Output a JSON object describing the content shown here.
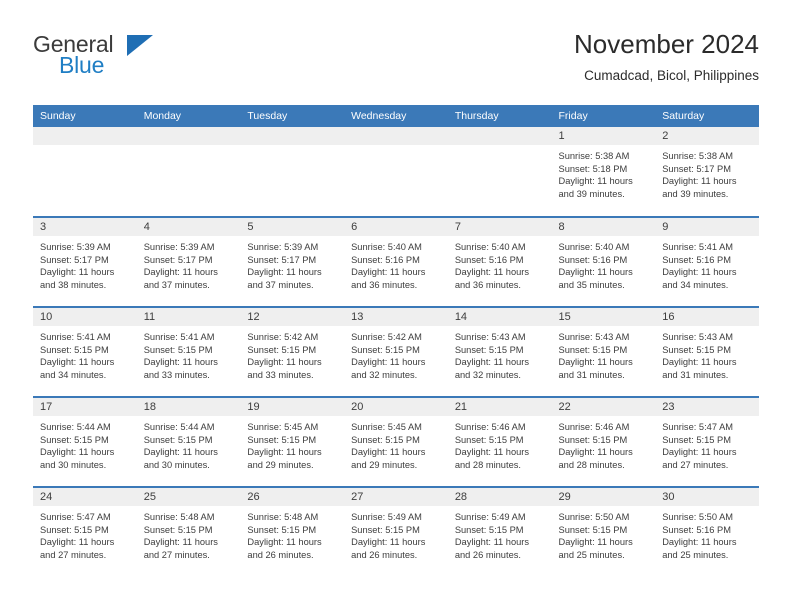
{
  "brand": {
    "line1": "General",
    "line2": "Blue",
    "triangle_icon": "triangle-icon",
    "accent_color": "#1f6eb4"
  },
  "header": {
    "title": "November 2024",
    "location": "Cumadcad, Bicol, Philippines"
  },
  "theme": {
    "header_blue": "#3b79b8",
    "daynum_band": "#efefef",
    "text": "#3d3d3d"
  },
  "weekday_headers": [
    "Sunday",
    "Monday",
    "Tuesday",
    "Wednesday",
    "Thursday",
    "Friday",
    "Saturday"
  ],
  "weeks": [
    [
      {
        "day": "",
        "sunrise": "",
        "sunset": "",
        "daylight1": "",
        "daylight2": "",
        "empty": true
      },
      {
        "day": "",
        "sunrise": "",
        "sunset": "",
        "daylight1": "",
        "daylight2": "",
        "empty": true
      },
      {
        "day": "",
        "sunrise": "",
        "sunset": "",
        "daylight1": "",
        "daylight2": "",
        "empty": true
      },
      {
        "day": "",
        "sunrise": "",
        "sunset": "",
        "daylight1": "",
        "daylight2": "",
        "empty": true
      },
      {
        "day": "",
        "sunrise": "",
        "sunset": "",
        "daylight1": "",
        "daylight2": "",
        "empty": true
      },
      {
        "day": "1",
        "sunrise": "Sunrise: 5:38 AM",
        "sunset": "Sunset: 5:18 PM",
        "daylight1": "Daylight: 11 hours",
        "daylight2": "and 39 minutes."
      },
      {
        "day": "2",
        "sunrise": "Sunrise: 5:38 AM",
        "sunset": "Sunset: 5:17 PM",
        "daylight1": "Daylight: 11 hours",
        "daylight2": "and 39 minutes."
      }
    ],
    [
      {
        "day": "3",
        "sunrise": "Sunrise: 5:39 AM",
        "sunset": "Sunset: 5:17 PM",
        "daylight1": "Daylight: 11 hours",
        "daylight2": "and 38 minutes."
      },
      {
        "day": "4",
        "sunrise": "Sunrise: 5:39 AM",
        "sunset": "Sunset: 5:17 PM",
        "daylight1": "Daylight: 11 hours",
        "daylight2": "and 37 minutes."
      },
      {
        "day": "5",
        "sunrise": "Sunrise: 5:39 AM",
        "sunset": "Sunset: 5:17 PM",
        "daylight1": "Daylight: 11 hours",
        "daylight2": "and 37 minutes."
      },
      {
        "day": "6",
        "sunrise": "Sunrise: 5:40 AM",
        "sunset": "Sunset: 5:16 PM",
        "daylight1": "Daylight: 11 hours",
        "daylight2": "and 36 minutes."
      },
      {
        "day": "7",
        "sunrise": "Sunrise: 5:40 AM",
        "sunset": "Sunset: 5:16 PM",
        "daylight1": "Daylight: 11 hours",
        "daylight2": "and 36 minutes."
      },
      {
        "day": "8",
        "sunrise": "Sunrise: 5:40 AM",
        "sunset": "Sunset: 5:16 PM",
        "daylight1": "Daylight: 11 hours",
        "daylight2": "and 35 minutes."
      },
      {
        "day": "9",
        "sunrise": "Sunrise: 5:41 AM",
        "sunset": "Sunset: 5:16 PM",
        "daylight1": "Daylight: 11 hours",
        "daylight2": "and 34 minutes."
      }
    ],
    [
      {
        "day": "10",
        "sunrise": "Sunrise: 5:41 AM",
        "sunset": "Sunset: 5:15 PM",
        "daylight1": "Daylight: 11 hours",
        "daylight2": "and 34 minutes."
      },
      {
        "day": "11",
        "sunrise": "Sunrise: 5:41 AM",
        "sunset": "Sunset: 5:15 PM",
        "daylight1": "Daylight: 11 hours",
        "daylight2": "and 33 minutes."
      },
      {
        "day": "12",
        "sunrise": "Sunrise: 5:42 AM",
        "sunset": "Sunset: 5:15 PM",
        "daylight1": "Daylight: 11 hours",
        "daylight2": "and 33 minutes."
      },
      {
        "day": "13",
        "sunrise": "Sunrise: 5:42 AM",
        "sunset": "Sunset: 5:15 PM",
        "daylight1": "Daylight: 11 hours",
        "daylight2": "and 32 minutes."
      },
      {
        "day": "14",
        "sunrise": "Sunrise: 5:43 AM",
        "sunset": "Sunset: 5:15 PM",
        "daylight1": "Daylight: 11 hours",
        "daylight2": "and 32 minutes."
      },
      {
        "day": "15",
        "sunrise": "Sunrise: 5:43 AM",
        "sunset": "Sunset: 5:15 PM",
        "daylight1": "Daylight: 11 hours",
        "daylight2": "and 31 minutes."
      },
      {
        "day": "16",
        "sunrise": "Sunrise: 5:43 AM",
        "sunset": "Sunset: 5:15 PM",
        "daylight1": "Daylight: 11 hours",
        "daylight2": "and 31 minutes."
      }
    ],
    [
      {
        "day": "17",
        "sunrise": "Sunrise: 5:44 AM",
        "sunset": "Sunset: 5:15 PM",
        "daylight1": "Daylight: 11 hours",
        "daylight2": "and 30 minutes."
      },
      {
        "day": "18",
        "sunrise": "Sunrise: 5:44 AM",
        "sunset": "Sunset: 5:15 PM",
        "daylight1": "Daylight: 11 hours",
        "daylight2": "and 30 minutes."
      },
      {
        "day": "19",
        "sunrise": "Sunrise: 5:45 AM",
        "sunset": "Sunset: 5:15 PM",
        "daylight1": "Daylight: 11 hours",
        "daylight2": "and 29 minutes."
      },
      {
        "day": "20",
        "sunrise": "Sunrise: 5:45 AM",
        "sunset": "Sunset: 5:15 PM",
        "daylight1": "Daylight: 11 hours",
        "daylight2": "and 29 minutes."
      },
      {
        "day": "21",
        "sunrise": "Sunrise: 5:46 AM",
        "sunset": "Sunset: 5:15 PM",
        "daylight1": "Daylight: 11 hours",
        "daylight2": "and 28 minutes."
      },
      {
        "day": "22",
        "sunrise": "Sunrise: 5:46 AM",
        "sunset": "Sunset: 5:15 PM",
        "daylight1": "Daylight: 11 hours",
        "daylight2": "and 28 minutes."
      },
      {
        "day": "23",
        "sunrise": "Sunrise: 5:47 AM",
        "sunset": "Sunset: 5:15 PM",
        "daylight1": "Daylight: 11 hours",
        "daylight2": "and 27 minutes."
      }
    ],
    [
      {
        "day": "24",
        "sunrise": "Sunrise: 5:47 AM",
        "sunset": "Sunset: 5:15 PM",
        "daylight1": "Daylight: 11 hours",
        "daylight2": "and 27 minutes."
      },
      {
        "day": "25",
        "sunrise": "Sunrise: 5:48 AM",
        "sunset": "Sunset: 5:15 PM",
        "daylight1": "Daylight: 11 hours",
        "daylight2": "and 27 minutes."
      },
      {
        "day": "26",
        "sunrise": "Sunrise: 5:48 AM",
        "sunset": "Sunset: 5:15 PM",
        "daylight1": "Daylight: 11 hours",
        "daylight2": "and 26 minutes."
      },
      {
        "day": "27",
        "sunrise": "Sunrise: 5:49 AM",
        "sunset": "Sunset: 5:15 PM",
        "daylight1": "Daylight: 11 hours",
        "daylight2": "and 26 minutes."
      },
      {
        "day": "28",
        "sunrise": "Sunrise: 5:49 AM",
        "sunset": "Sunset: 5:15 PM",
        "daylight1": "Daylight: 11 hours",
        "daylight2": "and 26 minutes."
      },
      {
        "day": "29",
        "sunrise": "Sunrise: 5:50 AM",
        "sunset": "Sunset: 5:15 PM",
        "daylight1": "Daylight: 11 hours",
        "daylight2": "and 25 minutes."
      },
      {
        "day": "30",
        "sunrise": "Sunrise: 5:50 AM",
        "sunset": "Sunset: 5:16 PM",
        "daylight1": "Daylight: 11 hours",
        "daylight2": "and 25 minutes."
      }
    ]
  ]
}
